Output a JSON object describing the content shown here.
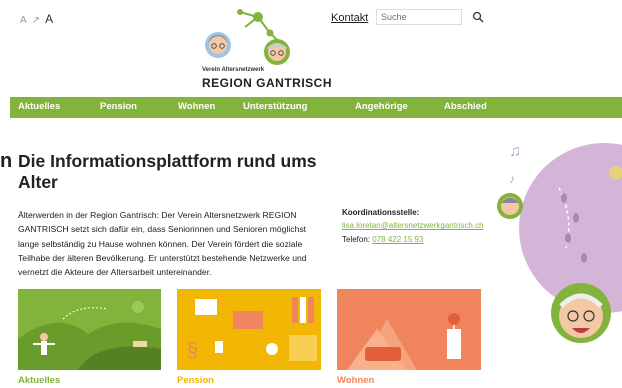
{
  "header": {
    "font_size_controls": [
      "A",
      "A",
      "A"
    ],
    "kontakt_label": "Kontakt",
    "search_placeholder": "Suche",
    "search_icon": "search-icon"
  },
  "logo": {
    "line1": "Verein Altersnetzwerk",
    "line2": "REGION GANTRISCH"
  },
  "nav": {
    "items": [
      "Aktuelles",
      "Pension",
      "Wohnen",
      "Unterstützung",
      "Angehörige",
      "Abschied"
    ]
  },
  "main": {
    "title": "Die Informationsplattform rund ums Alter",
    "intro": "Älterwerden in der Region Gantrisch: Der Verein Altersnetzwerk REGION GANTRISCH setzt sich dafür ein, dass Seniorinnen und Senioren möglichst lange selbständig zu Hause wohnen können. Der Verein fördert die soziale Teilhabe der älteren Bevölkerung. Er unterstützt bestehende Netzwerke und vernetzt die Akteure der Altersarbeit untereinander."
  },
  "coordination": {
    "label": "Koordinationsstelle:",
    "email": "lisa.loretan@altersnetzwerkgantrisch.ch",
    "phone_prefix": "Telefon:",
    "phone": "078 422 15 93"
  },
  "cards": [
    {
      "label": "Aktuelles",
      "bg": "#82b43c",
      "label_color": "#82b43c"
    },
    {
      "label": "Pension",
      "bg": "#f2b705",
      "label_color": "#f2b705"
    },
    {
      "label": "Wohnen",
      "bg": "#f0845c",
      "label_color": "#f0845c"
    }
  ],
  "colors": {
    "accent_green": "#82b43c",
    "accent_yellow": "#f2b705",
    "accent_orange": "#f0845c",
    "accent_purple": "#d4b5d8"
  }
}
